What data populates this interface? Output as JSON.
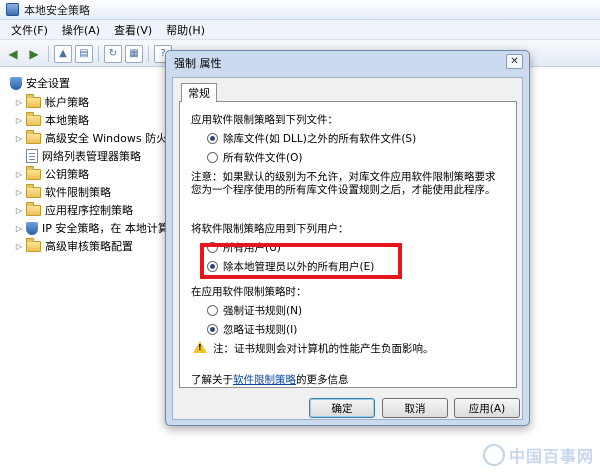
{
  "main_window": {
    "title": "本地安全策略"
  },
  "menubar": [
    {
      "label": "文件(F)"
    },
    {
      "label": "操作(A)"
    },
    {
      "label": "查看(V)"
    },
    {
      "label": "帮助(H)"
    }
  ],
  "tree": {
    "root": "安全设置",
    "items": [
      {
        "label": "帐户策略"
      },
      {
        "label": "本地策略"
      },
      {
        "label": "高级安全 Windows 防火"
      },
      {
        "label": "网络列表管理器策略"
      },
      {
        "label": "公钥策略"
      },
      {
        "label": "软件限制策略"
      },
      {
        "label": "应用程序控制策略"
      },
      {
        "label": "IP 安全策略，在 本地计算"
      },
      {
        "label": "高级审核策略配置"
      }
    ]
  },
  "dialog": {
    "title": "强制 属性",
    "close_glyph": "✕",
    "tab": "常规",
    "section1": "应用软件限制策略到下列文件：",
    "opt_exclude_libs": "除库文件(如 DLL)之外的所有软件文件(S)",
    "opt_all_files": "所有软件文件(O)",
    "note_line1": "注意：如果默认的级别为不允许，对库文件应用软件限制策略要求",
    "note_line2": "您为一个程序使用的所有库文件设置规则之后，才能使用此程序。",
    "section2": "将软件限制策略应用到下列用户：",
    "opt_all_users": "所有用户(U)",
    "opt_except_admins": "除本地管理员以外的所有用户(E)",
    "section3": "在应用软件限制策略时：",
    "opt_enforce_cert": "强制证书规则(N)",
    "opt_ignore_cert": "忽略证书规则(I)",
    "warning": "注：证书规则会对计算机的性能产生负面影响。",
    "info_prefix": "了解关于",
    "info_link": "软件限制策略",
    "info_suffix": "的更多信息",
    "btn_ok": "确定",
    "btn_cancel": "取消",
    "btn_apply": "应用(A)"
  },
  "colors": {
    "highlight": "#e8151b",
    "link": "#0b48a8"
  },
  "watermark": {
    "text": "中国百事网"
  }
}
